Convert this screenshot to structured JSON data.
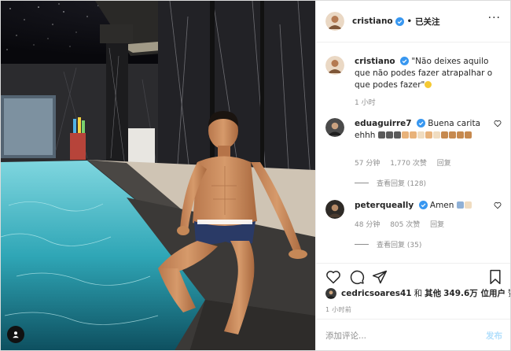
{
  "header": {
    "username": "cristiano",
    "separator": "•",
    "follow_status": "已关注",
    "more": "···"
  },
  "caption": {
    "username": "cristiano",
    "text": "\"Não deixes aquilo que não podes fazer atrapalhar o que podes fazer\"",
    "time": "1 小时"
  },
  "comments": [
    {
      "username": "eduaguirre7",
      "text": "Buena carita ehhh",
      "time": "57 分钟",
      "likes": "1,770 次赞",
      "reply": "回复",
      "view_replies": "查看回复 (128)"
    },
    {
      "username": "peterqueally",
      "text": "Amen",
      "time": "48 分钟",
      "likes": "805 次赞",
      "reply": "回复",
      "view_replies": "查看回复 (35)"
    }
  ],
  "likes": {
    "user": "cedricsoares41",
    "conj": "和",
    "others_label": "其他",
    "count": "349.6万 位用户",
    "suffix": "赞了"
  },
  "post_time": "1 小时前",
  "comment_input": {
    "placeholder": "添加评论...",
    "post_label": "发布"
  },
  "colors": {
    "verified": "#3897f0",
    "link_disabled": "#b2dffc",
    "muted": "#8e8e8e"
  },
  "icons": [
    "heart-icon",
    "comment-icon",
    "share-icon",
    "bookmark-icon",
    "verified-icon",
    "more-icon"
  ]
}
